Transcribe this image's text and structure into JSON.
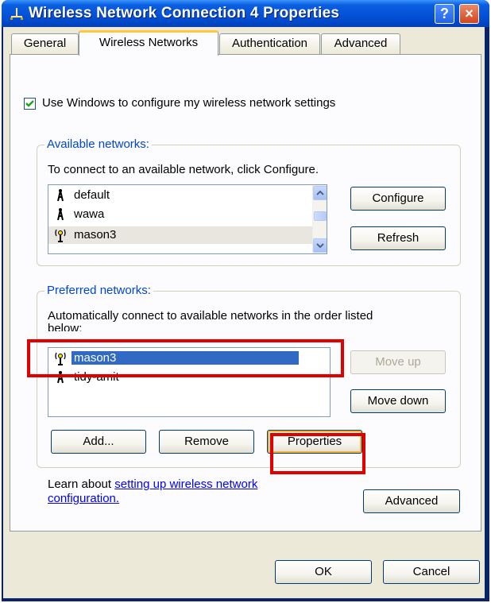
{
  "window": {
    "title": "Wireless Network Connection 4 Properties",
    "help_label": "?",
    "close_label": "×"
  },
  "tabs": [
    {
      "label": "General"
    },
    {
      "label": "Wireless Networks",
      "active": true
    },
    {
      "label": "Authentication"
    },
    {
      "label": "Advanced"
    }
  ],
  "use_windows_checkbox": {
    "label": "Use Windows to configure my wireless network settings",
    "checked": true
  },
  "available": {
    "legend": "Available networks:",
    "instruction": "To connect to an available network, click Configure.",
    "networks": [
      {
        "name": "default",
        "icon": "antenna-icon"
      },
      {
        "name": "wawa",
        "icon": "antenna-icon"
      },
      {
        "name": "mason3",
        "icon": "signal-radiating-antenna-icon"
      }
    ],
    "configure_label": "Configure",
    "refresh_label": "Refresh"
  },
  "preferred": {
    "legend": "Preferred networks:",
    "instruction_line1": "Automatically connect to available networks in the order listed",
    "instruction_line2": "below:",
    "networks": [
      {
        "name": "mason3",
        "icon": "signal-radiating-antenna-icon",
        "selected": true
      },
      {
        "name": "tidy-amit",
        "icon": "antenna-icon"
      }
    ],
    "move_up_label": "Move up",
    "move_down_label": "Move down",
    "add_label": "Add...",
    "remove_label": "Remove",
    "properties_label": "Properties"
  },
  "learn": {
    "prefix": "Learn about ",
    "link_line1": "setting up wireless network",
    "link_line2": "configuration.",
    "advanced_label": "Advanced"
  },
  "footer": {
    "ok_label": "OK",
    "cancel_label": "Cancel"
  },
  "colors": {
    "highlight_box": "#e10000",
    "selection": "#316ac5",
    "group_legend": "#0046d5"
  }
}
